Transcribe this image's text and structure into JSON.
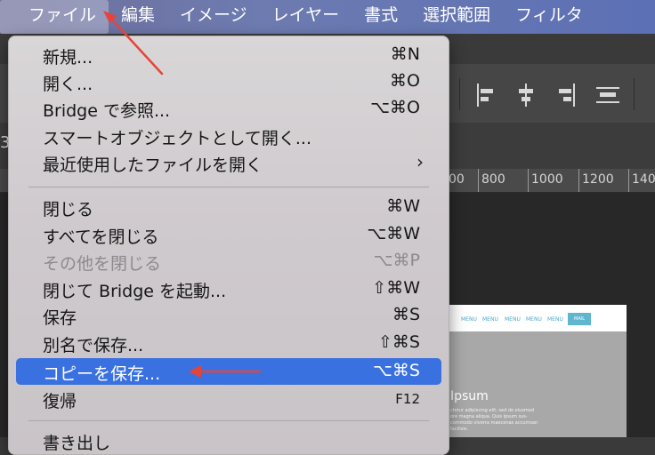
{
  "menubar": {
    "items": [
      {
        "label": "ファイル",
        "active": true
      },
      {
        "label": "編集"
      },
      {
        "label": "イメージ"
      },
      {
        "label": "レイヤー"
      },
      {
        "label": "書式"
      },
      {
        "label": "選択範囲"
      },
      {
        "label": "フィルタ"
      }
    ]
  },
  "ruler": {
    "ticks": [
      "00",
      "800",
      "1000",
      "1200",
      "140"
    ]
  },
  "left_edge_glyphs": [
    "3"
  ],
  "document_preview": {
    "nav_items": [
      "MENU",
      "MENU",
      "MENU",
      "MENU",
      "MENU"
    ],
    "nav_button": "MAIL",
    "heading": "Ipsum",
    "body": "ctetur adipiscing elit, sed do eiusmod ore magna aliqua. Quis ipsum sus- commodo viverra maecenas accumsan facilisis."
  },
  "file_menu": {
    "groups": [
      [
        {
          "label": "新規...",
          "shortcut": "⌘N"
        },
        {
          "label": "開く...",
          "shortcut": "⌘O"
        },
        {
          "label": "Bridge で参照...",
          "shortcut": "⌥⌘O"
        },
        {
          "label": "スマートオブジェクトとして開く...",
          "shortcut": ""
        },
        {
          "label": "最近使用したファイルを開く",
          "shortcut": "›",
          "submenu": true
        }
      ],
      [
        {
          "label": "閉じる",
          "shortcut": "⌘W"
        },
        {
          "label": "すべてを閉じる",
          "shortcut": "⌥⌘W"
        },
        {
          "label": "その他を閉じる",
          "shortcut": "⌥⌘P",
          "disabled": true
        },
        {
          "label": "閉じて Bridge を起動...",
          "shortcut": "⇧⌘W"
        },
        {
          "label": "保存",
          "shortcut": "⌘S"
        },
        {
          "label": "別名で保存...",
          "shortcut": "⇧⌘S"
        },
        {
          "label": "コピーを保存...",
          "shortcut": "⌥⌘S",
          "highlighted": true
        },
        {
          "label": "復帰",
          "shortcut": "F12"
        }
      ],
      [
        {
          "label": "書き出し",
          "shortcut": ""
        }
      ]
    ]
  },
  "colors": {
    "menubar": "#6d7bb0",
    "highlight": "#3a71e0",
    "annotation_arrow": "#e5443a"
  }
}
